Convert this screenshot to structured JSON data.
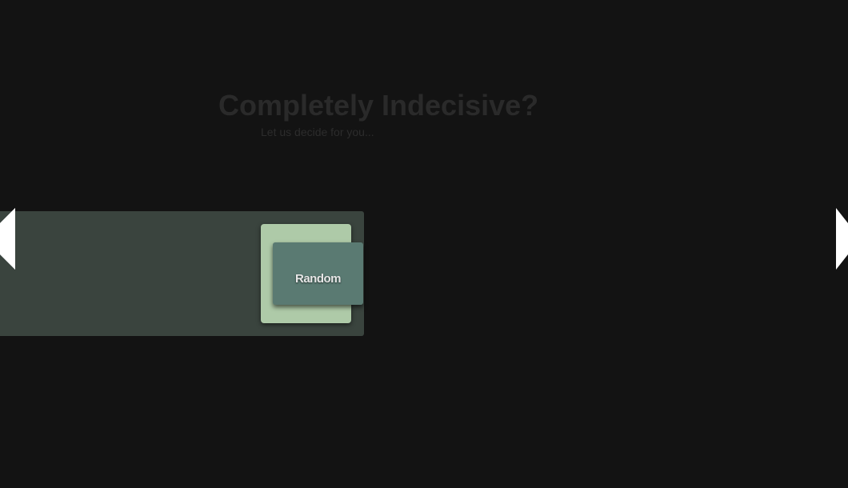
{
  "header": {
    "title": "Completely Indecisive?",
    "subtitle": "Let us decide for you..."
  },
  "main": {
    "random_button_label": "Random"
  },
  "colors": {
    "background": "#131313",
    "panel": "#3a443e",
    "card": "#aecaa8",
    "button": "#5a7a72",
    "arrow": "#ffffff"
  },
  "icons": {
    "prev": "arrow-left-icon",
    "next": "arrow-right-icon"
  }
}
